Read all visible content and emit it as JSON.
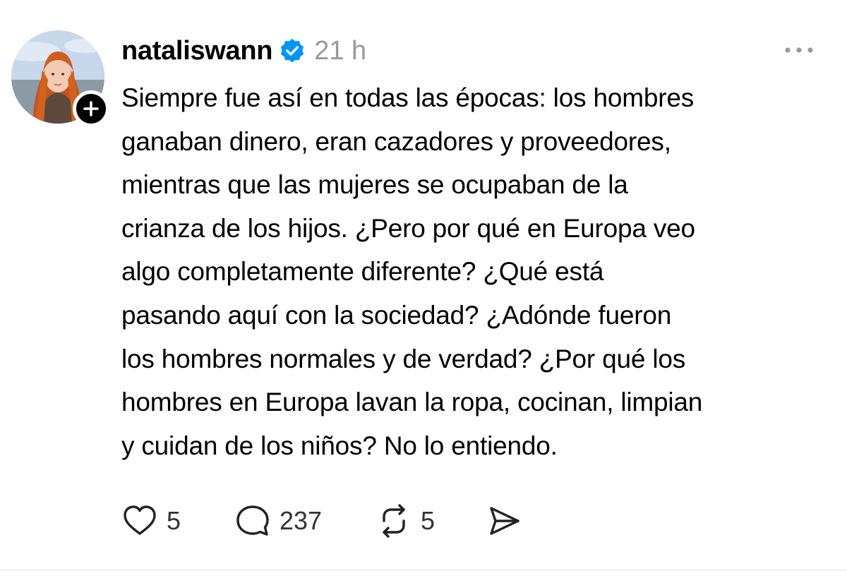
{
  "post": {
    "username": "nataliswann",
    "verified": true,
    "timestamp": "21 h",
    "text_lines": [
      "Siempre fue así en todas las épocas: los hombres",
      "ganaban dinero, eran cazadores y proveedores,",
      "mientras que las mujeres se ocupaban de la",
      "crianza de los hijos. ¿Pero por qué en Europa veo",
      "algo completamente diferente? ¿Qué está",
      "pasando aquí con la sociedad? ¿Adónde fueron",
      "los hombres normales y de verdad? ¿Por qué los",
      "hombres en Europa lavan la ropa, cocinan, limpian",
      "y cuidan de los niños? No lo entiendo."
    ]
  },
  "actions": {
    "likes": "5",
    "replies": "237",
    "reposts": "5"
  },
  "icons": {
    "like": "heart-icon",
    "reply": "comment-icon",
    "repost": "repost-icon",
    "share": "send-icon",
    "more": "more-icon",
    "follow": "plus-icon",
    "verified": "verified-badge-icon"
  },
  "colors": {
    "verified_badge": "#0095F6",
    "timestamp": "#999999",
    "text": "#000000"
  }
}
